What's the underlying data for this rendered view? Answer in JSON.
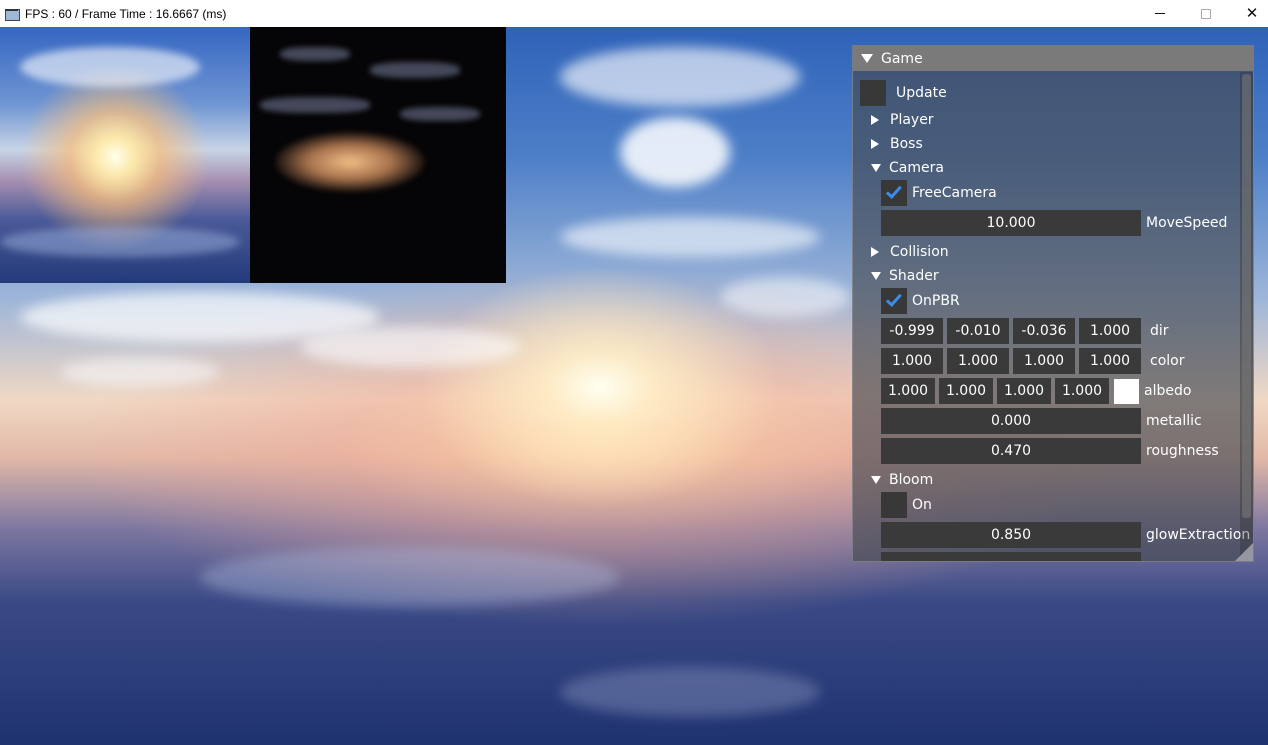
{
  "window": {
    "title": "FPS : 60 / Frame Time : 16.6667 (ms)"
  },
  "panel": {
    "title": "Game",
    "update_label": "Update",
    "player_label": "Player",
    "boss_label": "Boss",
    "camera": {
      "label": "Camera",
      "freecamera_label": "FreeCamera",
      "freecamera_checked": true,
      "movespeed_value": "10.000",
      "movespeed_label": "MoveSpeed"
    },
    "collision_label": "Collision",
    "shader": {
      "label": "Shader",
      "onpbr_label": "OnPBR",
      "onpbr_checked": true,
      "dir": [
        "-0.999",
        "-0.010",
        "-0.036",
        "1.000"
      ],
      "dir_label": "dir",
      "color": [
        "1.000",
        "1.000",
        "1.000",
        "1.000"
      ],
      "color_label": "color",
      "albedo": [
        "1.000",
        "1.000",
        "1.000",
        "1.000"
      ],
      "albedo_label": "albedo",
      "albedo_swatch": "#ffffff",
      "metallic_value": "0.000",
      "metallic_label": "metallic",
      "roughness_value": "0.470",
      "roughness_label": "roughness"
    },
    "bloom": {
      "label": "Bloom",
      "on_label": "On",
      "on_checked": false,
      "glow_value": "0.850",
      "glow_label": "glowExtraction"
    }
  },
  "colors": {
    "check_accent": "#3b8ce8",
    "title_bar": "#7a7a7a",
    "field_bg": "#3a3a3a"
  },
  "icons": [
    "app-icon",
    "minimize-icon",
    "maximize-icon",
    "close-icon",
    "collapse-arrow-icon",
    "expand-arrow-icon",
    "checkmark-icon"
  ]
}
